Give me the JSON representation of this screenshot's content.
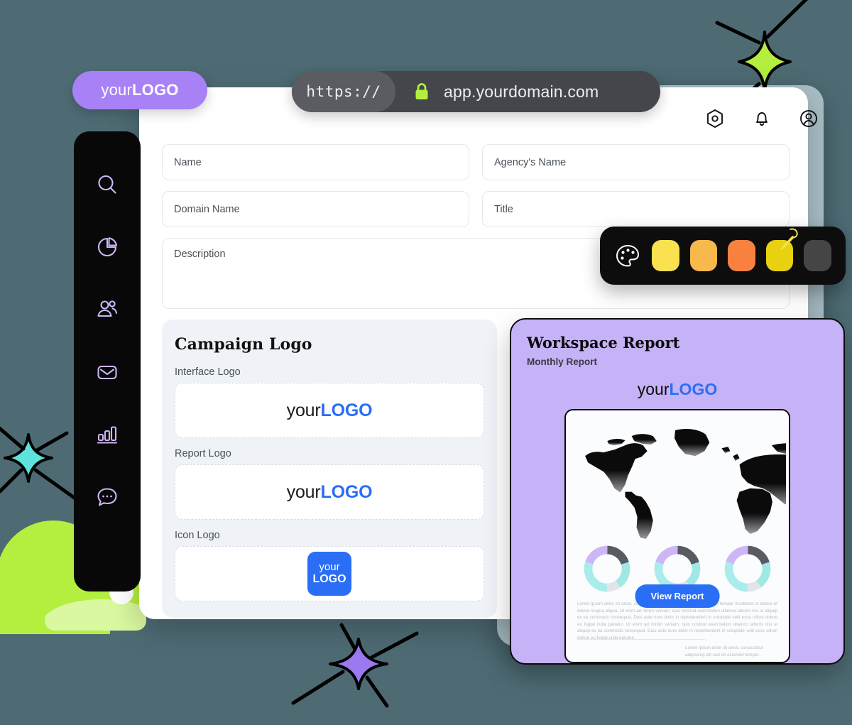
{
  "page": {
    "background_color": "#4e6b74"
  },
  "brand": {
    "logo_prefix": "your",
    "logo_suffix": "LOGO",
    "badge_color": "#a981f7",
    "accent_blue": "#2b6ef6"
  },
  "url_bar": {
    "scheme": "https://",
    "host": "app.yourdomain.com",
    "lock_icon": "lock-icon",
    "lock_color": "#b4ef3f",
    "bar_color": "#44464b"
  },
  "sidebar": {
    "background_color": "#080808",
    "icon_color": "#cdb6f5",
    "items": [
      {
        "name": "search",
        "icon": "search-icon"
      },
      {
        "name": "analytics",
        "icon": "pie-chart-icon"
      },
      {
        "name": "contacts",
        "icon": "users-icon"
      },
      {
        "name": "mail",
        "icon": "envelope-icon"
      },
      {
        "name": "reports",
        "icon": "bar-chart-icon"
      },
      {
        "name": "messages",
        "icon": "chat-bubble-icon"
      }
    ]
  },
  "header": {
    "icons": [
      {
        "name": "settings",
        "icon": "gear-hexagon-icon"
      },
      {
        "name": "notifications",
        "icon": "bell-icon"
      },
      {
        "name": "account",
        "icon": "user-avatar-icon"
      }
    ]
  },
  "form": {
    "fields": [
      {
        "name": "name",
        "placeholder": "Name"
      },
      {
        "name": "agency-name",
        "placeholder": "Agency's Name"
      },
      {
        "name": "domain-name",
        "placeholder": "Domain Name"
      },
      {
        "name": "title",
        "placeholder": "Title"
      },
      {
        "name": "description",
        "placeholder": "Description"
      }
    ]
  },
  "color_picker": {
    "palette_icon": "palette-icon",
    "background_color": "#0d0d0d",
    "eyedropper_icon": "eyedropper-icon",
    "swatches": [
      {
        "name": "yellow",
        "color": "#f9e14f"
      },
      {
        "name": "amber",
        "color": "#f7b84c"
      },
      {
        "name": "orange",
        "color": "#f8813f"
      },
      {
        "name": "gold",
        "color": "#e8d111",
        "selected": true
      },
      {
        "name": "gray",
        "color": "#454545"
      }
    ]
  },
  "campaign_logo": {
    "title": "Campaign Logo",
    "uploads": [
      {
        "name": "interface-logo",
        "label": "Interface Logo",
        "type": "wordmark"
      },
      {
        "name": "report-logo",
        "label": "Report Logo",
        "type": "wordmark"
      },
      {
        "name": "icon-logo",
        "label": "Icon Logo",
        "type": "icon"
      }
    ]
  },
  "workspace_report": {
    "title": "Workspace Report",
    "subtitle": "Monthly Report",
    "panel_color": "#c6b2f7",
    "button_label": "View Report",
    "map_icon": "world-map-icon",
    "lorem": "Lorem ipsum dolor sit amet, consectetur adipiscing elit, sed do eiusmod tempor incididunt ut labore et dolore magna aliqua. Ut enim ad minim veniam, quis nostrud exercitation ullamco laboris nisi ut aliquip ex ea commodo consequat. Duis aute irure dolor in reprehenderit in voluptate velit esse cillum dolore eu fugiat nulla pariatur. Ut enim ad minim veniam, quis nostrud exercitation ullamco laboris nisi ut aliquip ex ea commodo consequat. Duis aute irure dolor in reprehenderit in voluptate velit esse cillum dolore eu fugiat nulla pariatur.",
    "lorem_secondary": "Lorem ipsum dolor sit amet, consectetur adipiscing elit sed do eiusmod tempor."
  },
  "chart_data": [
    {
      "type": "pie",
      "name": "donut-chart-1",
      "labels": [
        "20%",
        "20%",
        "10%",
        "30%",
        "20%"
      ],
      "values": [
        20,
        20,
        10,
        30,
        20
      ],
      "colors": [
        "#5a5a62",
        "#9fe8e4",
        "#e2e4e8",
        "#a9ecea",
        "#cdb6f5"
      ],
      "title": "",
      "legend": "none"
    },
    {
      "type": "pie",
      "name": "donut-chart-2",
      "labels": [
        "20%",
        "20%",
        "10%",
        "30%",
        "20%"
      ],
      "values": [
        20,
        20,
        10,
        30,
        20
      ],
      "colors": [
        "#5a5a62",
        "#9fe8e4",
        "#e2e4e8",
        "#a9ecea",
        "#cdb6f5"
      ],
      "title": "",
      "legend": "none"
    },
    {
      "type": "pie",
      "name": "donut-chart-3",
      "labels": [
        "20%",
        "20%",
        "10%",
        "30%",
        "20%"
      ],
      "values": [
        20,
        20,
        10,
        30,
        20
      ],
      "colors": [
        "#5a5a62",
        "#9fe8e4",
        "#e2e4e8",
        "#a9ecea",
        "#cdb6f5"
      ],
      "title": "",
      "legend": "none"
    }
  ],
  "decorations": {
    "sparkles": [
      {
        "name": "sparkle-green",
        "color": "#b4ef3f"
      },
      {
        "name": "sparkle-cyan",
        "color": "#5de3dc"
      },
      {
        "name": "sparkle-purple",
        "color": "#9b7af0"
      }
    ],
    "blob": {
      "name": "green-blob",
      "color": "#b4ef3f"
    }
  }
}
